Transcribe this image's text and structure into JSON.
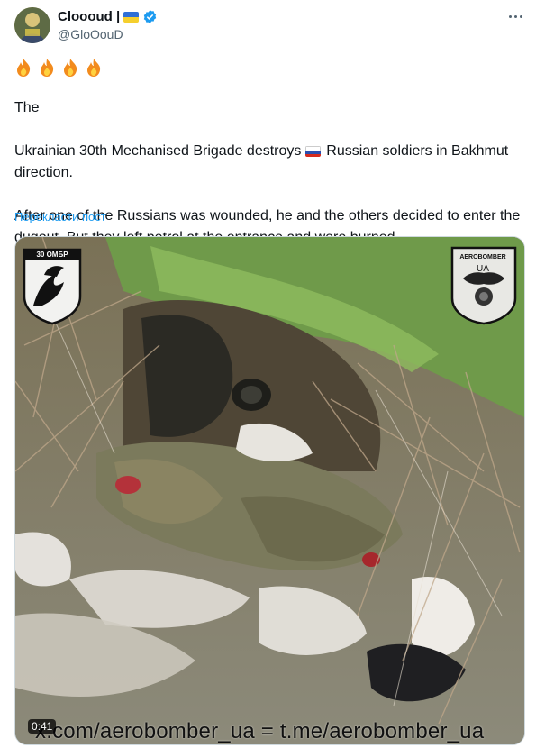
{
  "author": {
    "display_name": "Cloooud |",
    "handle": "@GloOouD",
    "verified": true
  },
  "tweet": {
    "emoji_line": "🔥🔥🔥🔥",
    "para1_a": "Ukrainian 30th Mechanised Brigade destroys ",
    "para1_prefix": "The ",
    "para1_b": "Russian soldiers in Bakhmut direction.",
    "para2": "After one of the Russians was wounded, he and the others decided to enter the dugout. But they left petrol at the entrance and were burned...."
  },
  "translate_link": "Перекласти пост",
  "media": {
    "logo_left_text": "30 ОМБР",
    "logo_right_text": "AEROBOMBER",
    "logo_right_sub": "UA",
    "timestamp": "0:41",
    "watermark": "x.com/aerobomber_ua  =  t.me/aerobomber_ua"
  },
  "colors": {
    "ua_blue": "#2f6fd6",
    "ua_yellow": "#f5cf2d",
    "link_blue": "#1d9bf0",
    "secondary_text": "#536471",
    "verified_blue": "#1d9bf0"
  },
  "icons": {
    "verified": "verified-badge-icon",
    "more": "more-dots-icon",
    "fire": "fire-emoji-icon"
  }
}
